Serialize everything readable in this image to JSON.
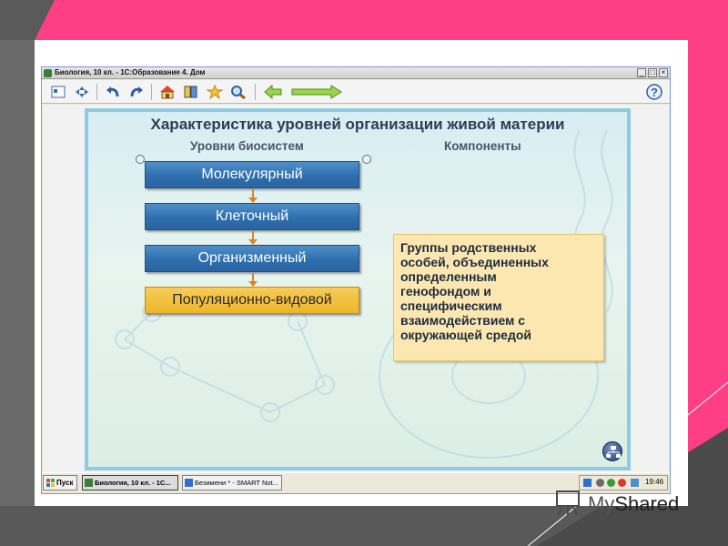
{
  "window": {
    "title": "Биология, 10 кл. - 1С:Образование 4. Дом",
    "minimize": "_",
    "maximize": "□",
    "close": "×"
  },
  "toolbar": {
    "icons": [
      "view-icon",
      "navigate-icon",
      "undo-icon",
      "redo-icon",
      "home-icon",
      "book-icon",
      "star-icon",
      "search-icon",
      "back-arrow-icon",
      "forward-arrow-icon",
      "help-icon"
    ]
  },
  "slide": {
    "title": "Характеристика уровней организации живой материи",
    "col_levels": "Уровни биосистем",
    "col_components": "Компоненты",
    "levels": [
      {
        "label": "Молекулярный",
        "active": false
      },
      {
        "label": "Клеточный",
        "active": false
      },
      {
        "label": "Организменный",
        "active": false
      },
      {
        "label": "Популяционно-видовой",
        "active": true
      }
    ],
    "info_lines": [
      "Группы родственных",
      "особей, объединенных",
      "определенным",
      "генофондом и",
      "специфическим",
      "взаимодействием с",
      "окружающей средой"
    ]
  },
  "taskbar": {
    "start": "Пуск",
    "tasks": [
      "Биология, 10 кл. - 1С...",
      "Безимени * - SMART Not..."
    ],
    "clock": "19:46"
  },
  "watermark": {
    "text_a": "My",
    "text_b": "Shared"
  },
  "colors": {
    "accent_bg": "#ff3f85",
    "level_blue": "#2f6fae",
    "level_active": "#efb52a",
    "info_bg": "#fde7b0"
  }
}
